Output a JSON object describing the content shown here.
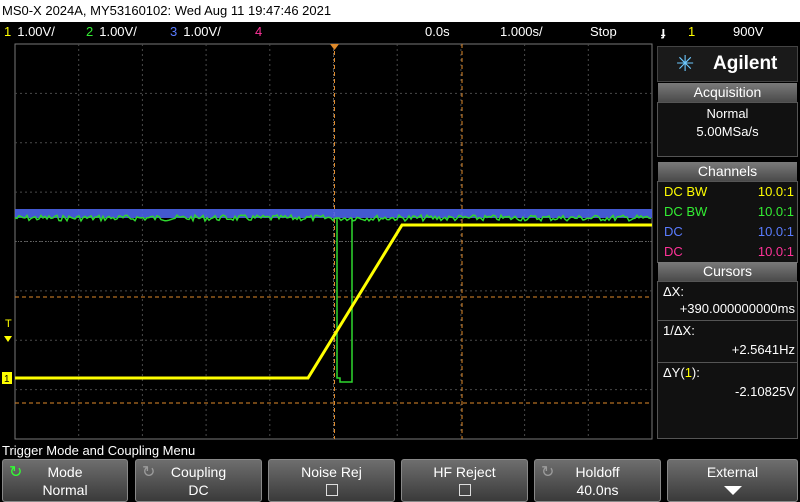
{
  "title": "MS0-X 2024A, MY53160102: Wed Aug 11 19:47:46 2021",
  "status": {
    "channels": [
      {
        "num": "1",
        "scale": "1.00V/",
        "color": "#ffff00"
      },
      {
        "num": "2",
        "scale": "1.00V/",
        "color": "#33ee33"
      },
      {
        "num": "3",
        "scale": "1.00V/",
        "color": "#5a7cff"
      },
      {
        "num": "4",
        "scale": "",
        "color": "#ff3399"
      }
    ],
    "delay": "0.0s",
    "timebase": "1.000s/",
    "run_state": "Stop",
    "trigger_icon": "ɟ",
    "trigger_source": "1",
    "trigger_level": "900V"
  },
  "brand": {
    "logo_icon": "agilent-spark-icon",
    "name": "Agilent"
  },
  "acquisition": {
    "header": "Acquisition",
    "mode": "Normal",
    "rate": "5.00MSa/s"
  },
  "channels_panel": {
    "header": "Channels",
    "rows": [
      {
        "coupling": "DC BW",
        "probe": "10.0:1",
        "color": "#ffff00"
      },
      {
        "coupling": "DC BW",
        "probe": "10.0:1",
        "color": "#33ee33"
      },
      {
        "coupling": "DC",
        "probe": "10.0:1",
        "color": "#5a7cff"
      },
      {
        "coupling": "DC",
        "probe": "10.0:1",
        "color": "#ff3399"
      }
    ]
  },
  "cursors": {
    "header": "Cursors",
    "dx_label": "ΔX:",
    "dx_value": "+390.000000000ms",
    "inv_dx_label": "1/ΔX:",
    "inv_dx_value": "+2.5641Hz",
    "dy_label_prefix": "ΔY(",
    "dy_label_ch": "1",
    "dy_label_suffix": "):",
    "dy_value": "-2.10825V"
  },
  "markers": {
    "trigger_level": "T",
    "channel": "1"
  },
  "menu": {
    "title": "Trigger Mode and Coupling Menu",
    "softkeys": [
      {
        "label": "Mode",
        "value": "Normal"
      },
      {
        "label": "Coupling",
        "value": "DC"
      },
      {
        "label": "Noise Rej",
        "value": ""
      },
      {
        "label": "HF Reject",
        "value": ""
      },
      {
        "label": "Holdoff",
        "value": "40.0ns"
      },
      {
        "label": "External",
        "value": ""
      }
    ]
  },
  "colors": {
    "ch1": "#ffff00",
    "ch2": "#33ee33",
    "ch3": "#5a7cff",
    "ch4": "#ff3399",
    "cursor": "#e08a2a",
    "grid": "#555555"
  }
}
